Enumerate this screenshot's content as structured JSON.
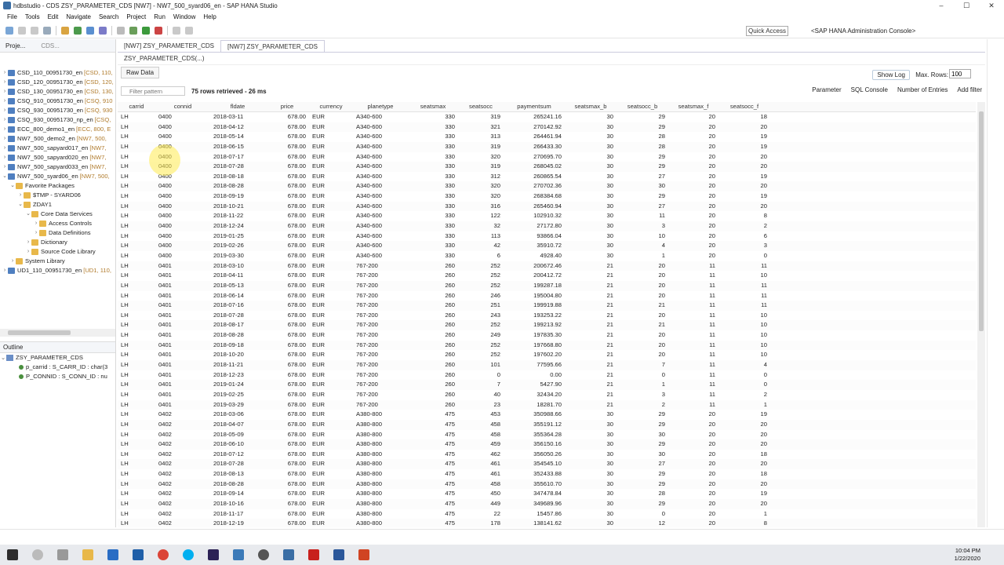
{
  "window": {
    "title": "hdbstudio - CDS ZSY_PARAMETER_CDS [NW7] - NW7_500_syard06_en - SAP HANA Studio"
  },
  "menu": [
    "File",
    "Tools",
    "Edit",
    "Navigate",
    "Search",
    "Project",
    "Run",
    "Window",
    "Help"
  ],
  "toolbar": {
    "quick_access": "Quick Access",
    "perspective": "<SAP HANA Administration Console>"
  },
  "left_tabs": [
    "Proje...",
    "CDS..."
  ],
  "project_tree": [
    {
      "label": "CSD_110_00951730_en",
      "suffix": "[CSD, 110,",
      "indent": 0,
      "twist": "›"
    },
    {
      "label": "CSD_120_00951730_en",
      "suffix": "[CSD, 120,",
      "indent": 0,
      "twist": "›"
    },
    {
      "label": "CSD_130_00951730_en",
      "suffix": "[CSD, 130,",
      "indent": 0,
      "twist": "›"
    },
    {
      "label": "CSQ_910_00951730_en",
      "suffix": "[CSQ, 910",
      "indent": 0,
      "twist": "›"
    },
    {
      "label": "CSQ_930_00951730_en",
      "suffix": "[CSQ, 930",
      "indent": 0,
      "twist": "›"
    },
    {
      "label": "CSQ_930_00951730_np_en",
      "suffix": "[CSQ,",
      "indent": 0,
      "twist": "›"
    },
    {
      "label": "ECC_800_demo1_en",
      "suffix": "[ECC, 800, E",
      "indent": 0,
      "twist": "›"
    },
    {
      "label": "NW7_500_demo2_en",
      "suffix": "[NW7, 500,",
      "indent": 0,
      "twist": "›"
    },
    {
      "label": "NW7_500_sapyard017_en",
      "suffix": "[NW7,",
      "indent": 0,
      "twist": "›"
    },
    {
      "label": "NW7_500_sapyard020_en",
      "suffix": "[NW7,",
      "indent": 0,
      "twist": "›"
    },
    {
      "label": "NW7_500_sapyard033_en",
      "suffix": "[NW7,",
      "indent": 0,
      "twist": "›"
    },
    {
      "label": "NW7_500_syard06_en",
      "suffix": "[NW7, 500,",
      "indent": 0,
      "twist": "⌄"
    },
    {
      "label": "Favorite Packages",
      "suffix": "",
      "indent": 1,
      "twist": "⌄"
    },
    {
      "label": "$TMP - SYARD06",
      "suffix": "",
      "indent": 2,
      "twist": "›"
    },
    {
      "label": "ZDAY1",
      "suffix": "",
      "indent": 2,
      "twist": "⌄"
    },
    {
      "label": "Core Data Services",
      "suffix": "",
      "indent": 3,
      "twist": "⌄"
    },
    {
      "label": "Access Controls",
      "suffix": "",
      "indent": 4,
      "twist": "›"
    },
    {
      "label": "Data Definitions",
      "suffix": "",
      "indent": 4,
      "twist": "›"
    },
    {
      "label": "Dictionary",
      "suffix": "",
      "indent": 3,
      "twist": "›"
    },
    {
      "label": "Source Code Library",
      "suffix": "",
      "indent": 3,
      "twist": "›"
    },
    {
      "label": "System Library",
      "suffix": "",
      "indent": 1,
      "twist": "›"
    },
    {
      "label": "UD1_110_00951730_en",
      "suffix": "[UD1, 110,",
      "indent": 0,
      "twist": "›"
    }
  ],
  "outline": {
    "title": "Outline",
    "root": "ZSY_PARAMETER_CDS",
    "children": [
      "p_carrid : S_CARR_ID : char(3",
      "P_CONNID : S_CONN_ID : nu"
    ]
  },
  "editor_tabs": [
    "[NW7] ZSY_PARAMETER_CDS",
    "[NW7] ZSY_PARAMETER_CDS"
  ],
  "breadcrumb": "ZSY_PARAMETER_CDS(...)",
  "subtab": "Raw Data",
  "show_log": "Show Log",
  "max_rows_label": "Max. Rows:",
  "max_rows_value": "100",
  "filter_placeholder": "Filter pattern",
  "rows_info": "75 rows retrieved - 26 ms",
  "right_tools": [
    "Parameter",
    "SQL Console",
    "Number of Entries",
    "Add filter"
  ],
  "columns": [
    "carrid",
    "connid",
    "fldate",
    "price",
    "currency",
    "planetype",
    "seatsmax",
    "seatsocc",
    "paymentsum",
    "seatsmax_b",
    "seatsocc_b",
    "seatsmax_f",
    "seatsocc_f"
  ],
  "rows": [
    [
      "LH",
      "0400",
      "2018-03-11",
      "678.00",
      "EUR",
      "A340-600",
      "330",
      "319",
      "265241.16",
      "30",
      "29",
      "20",
      "18"
    ],
    [
      "LH",
      "0400",
      "2018-04-12",
      "678.00",
      "EUR",
      "A340-600",
      "330",
      "321",
      "270142.92",
      "30",
      "29",
      "20",
      "20"
    ],
    [
      "LH",
      "0400",
      "2018-05-14",
      "678.00",
      "EUR",
      "A340-600",
      "330",
      "313",
      "264461.94",
      "30",
      "28",
      "20",
      "19"
    ],
    [
      "LH",
      "0400",
      "2018-06-15",
      "678.00",
      "EUR",
      "A340-600",
      "330",
      "319",
      "266433.30",
      "30",
      "28",
      "20",
      "19"
    ],
    [
      "LH",
      "0400",
      "2018-07-17",
      "678.00",
      "EUR",
      "A340-600",
      "330",
      "320",
      "270695.70",
      "30",
      "29",
      "20",
      "20"
    ],
    [
      "LH",
      "0400",
      "2018-07-28",
      "678.00",
      "EUR",
      "A340-600",
      "330",
      "319",
      "268045.02",
      "30",
      "29",
      "20",
      "20"
    ],
    [
      "LH",
      "0400",
      "2018-08-18",
      "678.00",
      "EUR",
      "A340-600",
      "330",
      "312",
      "260865.54",
      "30",
      "27",
      "20",
      "19"
    ],
    [
      "LH",
      "0400",
      "2018-08-28",
      "678.00",
      "EUR",
      "A340-600",
      "330",
      "320",
      "270702.36",
      "30",
      "30",
      "20",
      "20"
    ],
    [
      "LH",
      "0400",
      "2018-09-19",
      "678.00",
      "EUR",
      "A340-600",
      "330",
      "320",
      "268384.68",
      "30",
      "29",
      "20",
      "19"
    ],
    [
      "LH",
      "0400",
      "2018-10-21",
      "678.00",
      "EUR",
      "A340-600",
      "330",
      "316",
      "265460.94",
      "30",
      "27",
      "20",
      "20"
    ],
    [
      "LH",
      "0400",
      "2018-11-22",
      "678.00",
      "EUR",
      "A340-600",
      "330",
      "122",
      "102910.32",
      "30",
      "11",
      "20",
      "8"
    ],
    [
      "LH",
      "0400",
      "2018-12-24",
      "678.00",
      "EUR",
      "A340-600",
      "330",
      "32",
      "27172.80",
      "30",
      "3",
      "20",
      "2"
    ],
    [
      "LH",
      "0400",
      "2019-01-25",
      "678.00",
      "EUR",
      "A340-600",
      "330",
      "113",
      "93866.04",
      "30",
      "10",
      "20",
      "6"
    ],
    [
      "LH",
      "0400",
      "2019-02-26",
      "678.00",
      "EUR",
      "A340-600",
      "330",
      "42",
      "35910.72",
      "30",
      "4",
      "20",
      "3"
    ],
    [
      "LH",
      "0400",
      "2019-03-30",
      "678.00",
      "EUR",
      "A340-600",
      "330",
      "6",
      "4928.40",
      "30",
      "1",
      "20",
      "0"
    ],
    [
      "LH",
      "0401",
      "2018-03-10",
      "678.00",
      "EUR",
      "767-200",
      "260",
      "252",
      "200672.46",
      "21",
      "20",
      "11",
      "11"
    ],
    [
      "LH",
      "0401",
      "2018-04-11",
      "678.00",
      "EUR",
      "767-200",
      "260",
      "252",
      "200412.72",
      "21",
      "20",
      "11",
      "10"
    ],
    [
      "LH",
      "0401",
      "2018-05-13",
      "678.00",
      "EUR",
      "767-200",
      "260",
      "252",
      "199287.18",
      "21",
      "20",
      "11",
      "11"
    ],
    [
      "LH",
      "0401",
      "2018-06-14",
      "678.00",
      "EUR",
      "767-200",
      "260",
      "246",
      "195004.80",
      "21",
      "20",
      "11",
      "11"
    ],
    [
      "LH",
      "0401",
      "2018-07-16",
      "678.00",
      "EUR",
      "767-200",
      "260",
      "251",
      "199919.88",
      "21",
      "21",
      "11",
      "11"
    ],
    [
      "LH",
      "0401",
      "2018-07-28",
      "678.00",
      "EUR",
      "767-200",
      "260",
      "243",
      "193253.22",
      "21",
      "20",
      "11",
      "10"
    ],
    [
      "LH",
      "0401",
      "2018-08-17",
      "678.00",
      "EUR",
      "767-200",
      "260",
      "252",
      "199213.92",
      "21",
      "21",
      "11",
      "10"
    ],
    [
      "LH",
      "0401",
      "2018-08-28",
      "678.00",
      "EUR",
      "767-200",
      "260",
      "249",
      "197835.30",
      "21",
      "20",
      "11",
      "10"
    ],
    [
      "LH",
      "0401",
      "2018-09-18",
      "678.00",
      "EUR",
      "767-200",
      "260",
      "252",
      "197668.80",
      "21",
      "20",
      "11",
      "10"
    ],
    [
      "LH",
      "0401",
      "2018-10-20",
      "678.00",
      "EUR",
      "767-200",
      "260",
      "252",
      "197602.20",
      "21",
      "20",
      "11",
      "10"
    ],
    [
      "LH",
      "0401",
      "2018-11-21",
      "678.00",
      "EUR",
      "767-200",
      "260",
      "101",
      "77595.66",
      "21",
      "7",
      "11",
      "4"
    ],
    [
      "LH",
      "0401",
      "2018-12-23",
      "678.00",
      "EUR",
      "767-200",
      "260",
      "0",
      "0.00",
      "21",
      "0",
      "11",
      "0"
    ],
    [
      "LH",
      "0401",
      "2019-01-24",
      "678.00",
      "EUR",
      "767-200",
      "260",
      "7",
      "5427.90",
      "21",
      "1",
      "11",
      "0"
    ],
    [
      "LH",
      "0401",
      "2019-02-25",
      "678.00",
      "EUR",
      "767-200",
      "260",
      "40",
      "32434.20",
      "21",
      "3",
      "11",
      "2"
    ],
    [
      "LH",
      "0401",
      "2019-03-29",
      "678.00",
      "EUR",
      "767-200",
      "260",
      "23",
      "18281.70",
      "21",
      "2",
      "11",
      "1"
    ],
    [
      "LH",
      "0402",
      "2018-03-06",
      "678.00",
      "EUR",
      "A380-800",
      "475",
      "453",
      "350988.66",
      "30",
      "29",
      "20",
      "19"
    ],
    [
      "LH",
      "0402",
      "2018-04-07",
      "678.00",
      "EUR",
      "A380-800",
      "475",
      "458",
      "355191.12",
      "30",
      "29",
      "20",
      "20"
    ],
    [
      "LH",
      "0402",
      "2018-05-09",
      "678.00",
      "EUR",
      "A380-800",
      "475",
      "458",
      "355364.28",
      "30",
      "30",
      "20",
      "20"
    ],
    [
      "LH",
      "0402",
      "2018-06-10",
      "678.00",
      "EUR",
      "A380-800",
      "475",
      "459",
      "356150.16",
      "30",
      "29",
      "20",
      "20"
    ],
    [
      "LH",
      "0402",
      "2018-07-12",
      "678.00",
      "EUR",
      "A380-800",
      "475",
      "462",
      "356050.26",
      "30",
      "30",
      "20",
      "18"
    ],
    [
      "LH",
      "0402",
      "2018-07-28",
      "678.00",
      "EUR",
      "A380-800",
      "475",
      "461",
      "354545.10",
      "30",
      "27",
      "20",
      "20"
    ],
    [
      "LH",
      "0402",
      "2018-08-13",
      "678.00",
      "EUR",
      "A380-800",
      "475",
      "461",
      "352433.88",
      "30",
      "29",
      "20",
      "18"
    ],
    [
      "LH",
      "0402",
      "2018-08-28",
      "678.00",
      "EUR",
      "A380-800",
      "475",
      "458",
      "355610.70",
      "30",
      "29",
      "20",
      "20"
    ],
    [
      "LH",
      "0402",
      "2018-09-14",
      "678.00",
      "EUR",
      "A380-800",
      "475",
      "450",
      "347478.84",
      "30",
      "28",
      "20",
      "19"
    ],
    [
      "LH",
      "0402",
      "2018-10-16",
      "678.00",
      "EUR",
      "A380-800",
      "475",
      "449",
      "349689.96",
      "30",
      "29",
      "20",
      "20"
    ],
    [
      "LH",
      "0402",
      "2018-11-17",
      "678.00",
      "EUR",
      "A380-800",
      "475",
      "22",
      "15457.86",
      "30",
      "0",
      "20",
      "1"
    ],
    [
      "LH",
      "0402",
      "2018-12-19",
      "678.00",
      "EUR",
      "A380-800",
      "475",
      "178",
      "138141.62",
      "30",
      "12",
      "20",
      "8"
    ]
  ],
  "taskbar": {
    "time": "10:04 PM",
    "date": "1/22/2020"
  },
  "colors": {
    "accent": "#3a6ea5",
    "folder": "#e8b84a",
    "highlight": "#ffeb50"
  }
}
